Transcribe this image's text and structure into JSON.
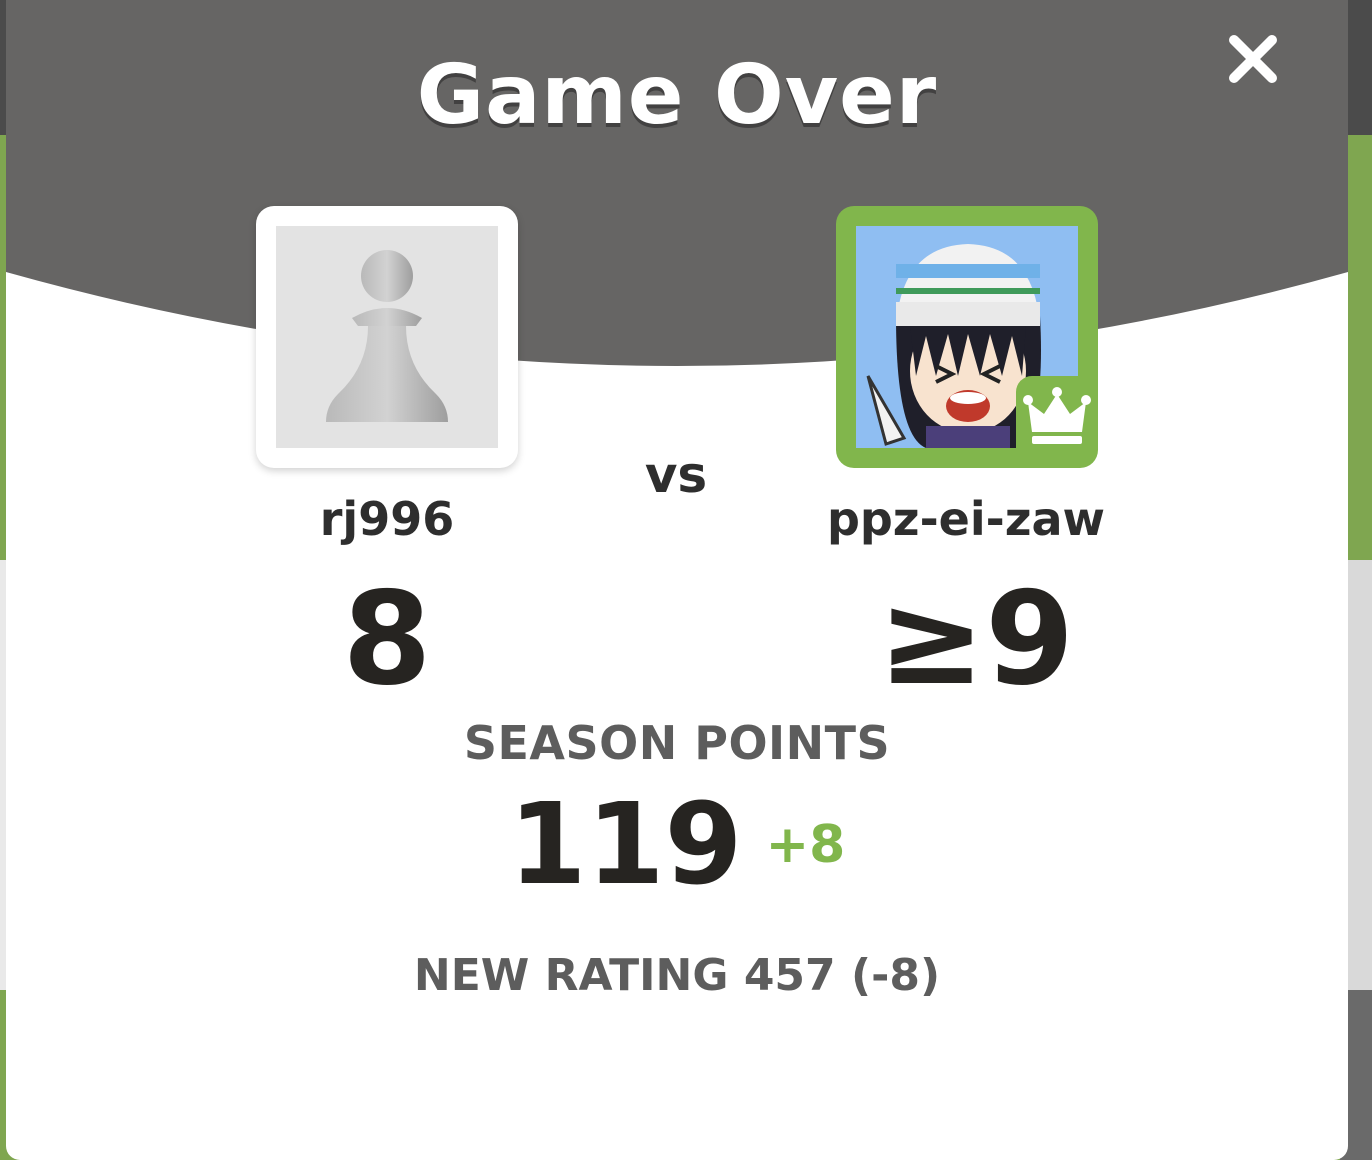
{
  "dialog": {
    "title": "Game Over",
    "close_icon": "close-icon"
  },
  "players": {
    "left": {
      "username": "rj996",
      "score": "8",
      "avatar_icon": "pawn-icon"
    },
    "vs_label": "vs",
    "right": {
      "username": "ppz-ei-zaw",
      "score": "≥9",
      "avatar_icon": "cartoon-avatar",
      "badge_icon": "crown-icon"
    }
  },
  "season": {
    "label": "SEASON POINTS",
    "value": "119",
    "delta": "+8"
  },
  "rating": {
    "text": "NEW RATING 457 (-8)"
  },
  "colors": {
    "header": "#666564",
    "accent_green": "#81b64c",
    "text_dark": "#262421",
    "text_muted": "#5d5d5d"
  }
}
